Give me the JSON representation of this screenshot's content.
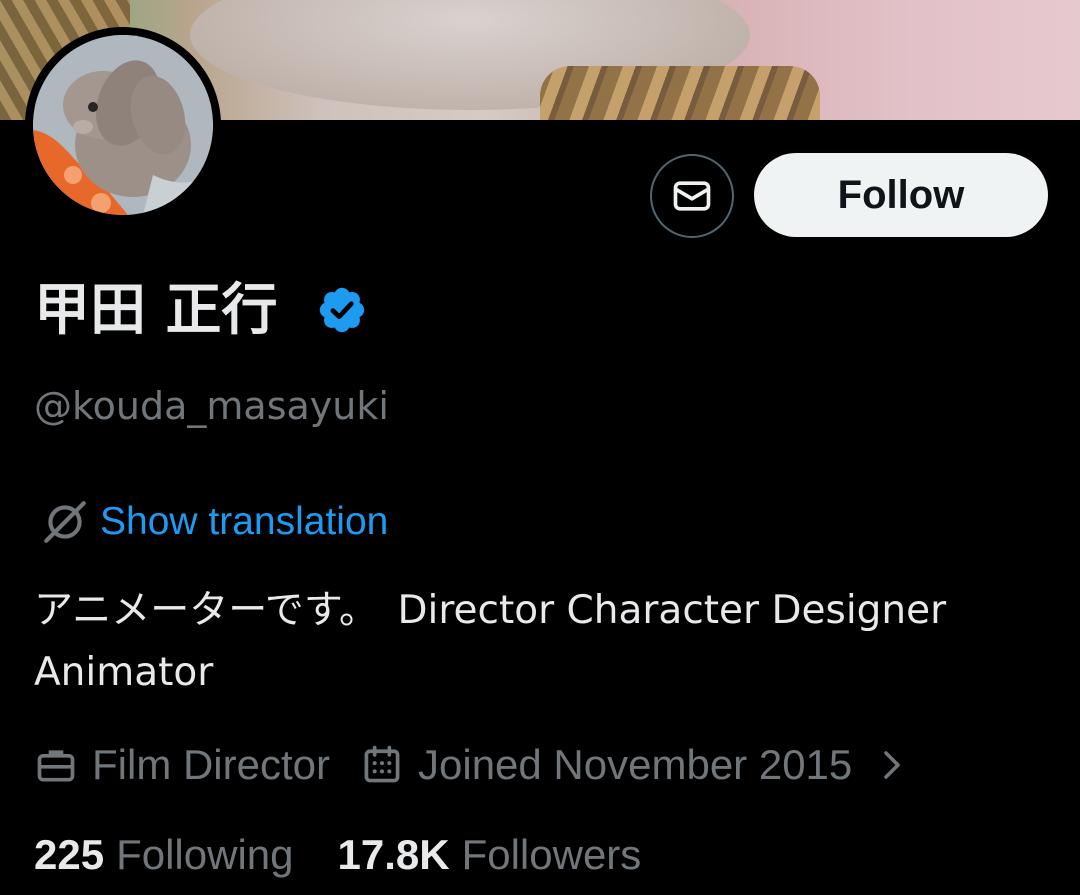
{
  "profile": {
    "display_name": "甲田 正行",
    "handle": "@kouda_masayuki",
    "verified": true,
    "translation_link": "Show translation",
    "bio": "アニメーターです。　Director Character Designer Animator",
    "profession": "Film Director",
    "joined": "Joined November 2015",
    "following_count": "225",
    "following_label": "Following",
    "followers_count": "17.8K",
    "followers_label": "Followers"
  },
  "actions": {
    "follow_label": "Follow"
  },
  "icons": {
    "message": "envelope-icon",
    "verified": "verified-badge-icon",
    "translate": "globe-icon",
    "profession": "briefcase-icon",
    "joined": "calendar-icon",
    "more": "chevron-right-icon"
  },
  "colors": {
    "background": "#000000",
    "primary_text": "#e7e9ea",
    "secondary_text": "#71767b",
    "link": "#1d9bf0",
    "verified": "#1d9bf0",
    "follow_button_bg": "#eff3f4"
  }
}
